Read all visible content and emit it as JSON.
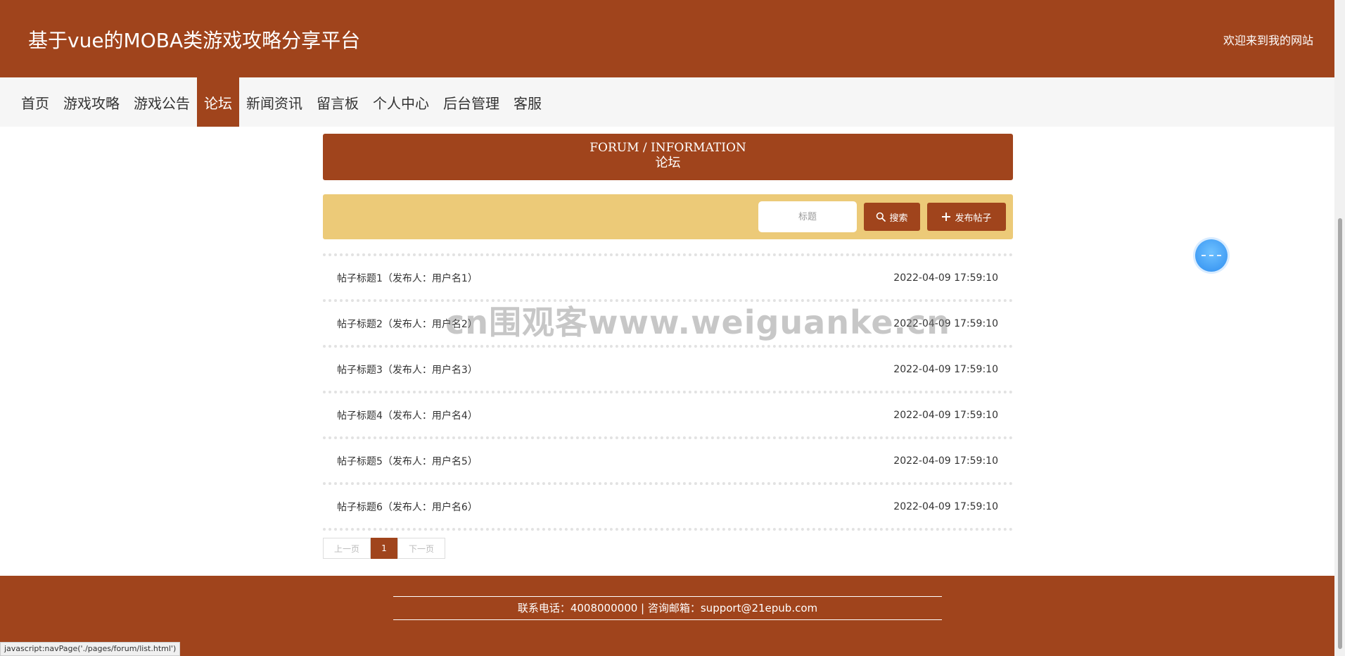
{
  "header": {
    "site_title": "基于vue的MOBA类游戏攻略分享平台",
    "welcome": "欢迎来到我的网站"
  },
  "nav": {
    "items": [
      {
        "label": "首页",
        "active": false
      },
      {
        "label": "游戏攻略",
        "active": false
      },
      {
        "label": "游戏公告",
        "active": false
      },
      {
        "label": "论坛",
        "active": true
      },
      {
        "label": "新闻资讯",
        "active": false
      },
      {
        "label": "留言板",
        "active": false
      },
      {
        "label": "个人中心",
        "active": false
      },
      {
        "label": "后台管理",
        "active": false
      },
      {
        "label": "客服",
        "active": false
      }
    ]
  },
  "banner": {
    "title_en": "FORUM / INFORMATION",
    "title_cn": "论坛"
  },
  "search": {
    "placeholder": "标题",
    "search_label": "搜索",
    "publish_label": "发布帖子"
  },
  "posts": [
    {
      "title": "帖子标题1（发布人：用户名1）",
      "time": "2022-04-09 17:59:10"
    },
    {
      "title": "帖子标题2（发布人：用户名2）",
      "time": "2022-04-09 17:59:10"
    },
    {
      "title": "帖子标题3（发布人：用户名3）",
      "time": "2022-04-09 17:59:10"
    },
    {
      "title": "帖子标题4（发布人：用户名4）",
      "time": "2022-04-09 17:59:10"
    },
    {
      "title": "帖子标题5（发布人：用户名5）",
      "time": "2022-04-09 17:59:10"
    },
    {
      "title": "帖子标题6（发布人：用户名6）",
      "time": "2022-04-09 17:59:10"
    }
  ],
  "pager": {
    "prev": "上一页",
    "current": "1",
    "next": "下一页"
  },
  "watermark": "cn围观客www.weiguanke.cn",
  "footer": {
    "contact": "联系电话：4008000000 | 咨询邮箱：support@21epub.com"
  },
  "status_bar": {
    "link": "javascript:navPage('./pages/forum/list.html')"
  },
  "colors": {
    "primary": "#a0441c",
    "search_bar": "#ecca78",
    "nav_bg": "#f6f6f6"
  }
}
